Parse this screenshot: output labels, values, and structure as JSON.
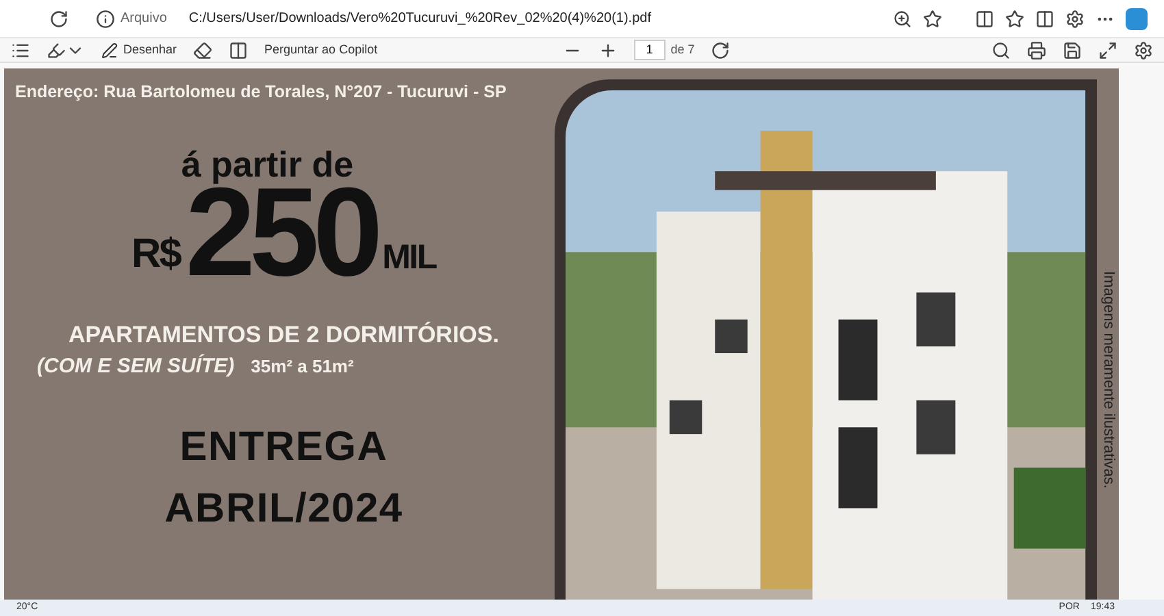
{
  "browser": {
    "address_label": "Arquivo",
    "url": "C:/Users/User/Downloads/Vero%20Tucuruvi_%20Rev_02%20(4)%20(1).pdf"
  },
  "pdf_toolbar": {
    "draw_label": "Desenhar",
    "copilot_label": "Perguntar ao Copilot",
    "page": "1",
    "page_total": "de 7"
  },
  "flyer": {
    "address": "Endereço: Rua Bartolomeu de Torales, N°207 - Tucuruvi - SP",
    "from_label": "á partir de",
    "currency": "R$",
    "price": "250",
    "unit": "MIL",
    "headline": "APARTAMENTOS DE 2 DORMITÓRIOS.",
    "suite_note": "(COM E SEM SUÍTE)",
    "area": "35m² a 51m²",
    "delivery_label": "ENTREGA",
    "delivery_date": "ABRIL/2024",
    "disclaimer": "Imagens meramente ilustrativas."
  },
  "taskbar": {
    "weather": "20°C",
    "language": "POR",
    "time": "19:43"
  }
}
